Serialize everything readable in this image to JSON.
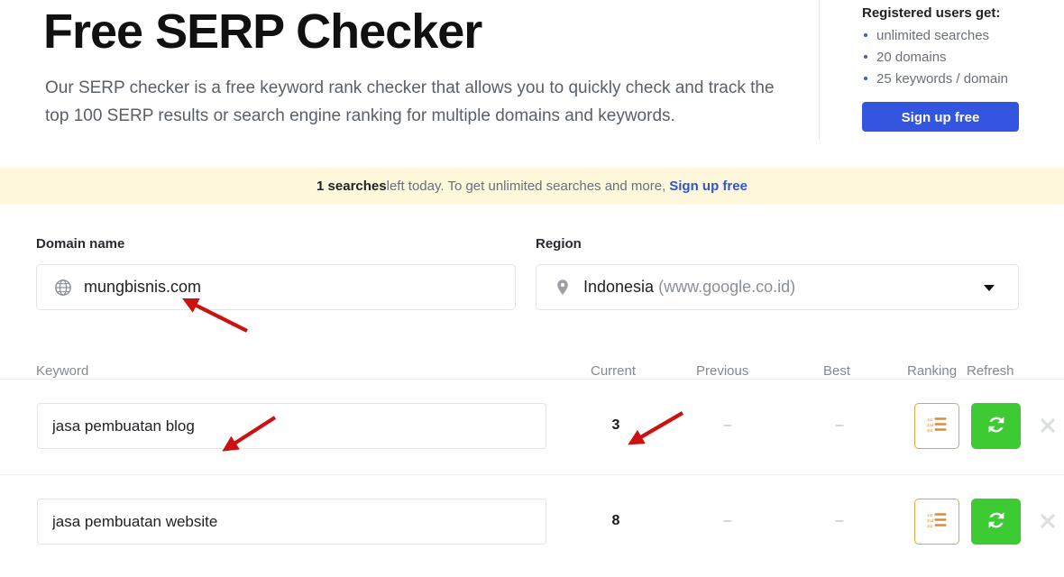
{
  "hero": {
    "title": "Free SERP Checker",
    "description": "Our SERP checker is a free keyword rank checker that allows you to quickly check and track the top 100 SERP results or search engine ranking for multiple domains and keywords.",
    "registered": {
      "title": "Registered users get:",
      "items": [
        "unlimited searches",
        "20 domains",
        "25 keywords / domain"
      ],
      "signup_label": "Sign up free"
    }
  },
  "banner": {
    "count": "1 searches",
    "text": " left today. To get unlimited searches and more,",
    "link": "Sign up free"
  },
  "form": {
    "domain": {
      "label": "Domain name",
      "value": "mungbisnis.com",
      "placeholder": "Enter domain name",
      "icon": "globe-icon"
    },
    "region": {
      "label": "Region",
      "country": "Indonesia",
      "engine": "(www.google.co.id)",
      "icon": "map-pin-icon"
    }
  },
  "table": {
    "headers": {
      "keyword": "Keyword",
      "current": "Current",
      "previous": "Previous",
      "best": "Best",
      "ranking": "Ranking",
      "refresh": "Refresh"
    },
    "rows": [
      {
        "keyword": "jasa pembuatan blog",
        "placeholder": "Enter keyword",
        "current": "3",
        "previous": "–",
        "best": "–"
      },
      {
        "keyword": "jasa pembuatan website",
        "placeholder": "Enter keyword",
        "current": "8",
        "previous": "–",
        "best": "–"
      }
    ]
  },
  "colors": {
    "accent_blue": "#3355e0",
    "banner_bg": "#fdf8dc",
    "refresh_green": "#3dca33",
    "ranking_orange": "#e8a33d",
    "annotation_red": "#cc1111"
  }
}
